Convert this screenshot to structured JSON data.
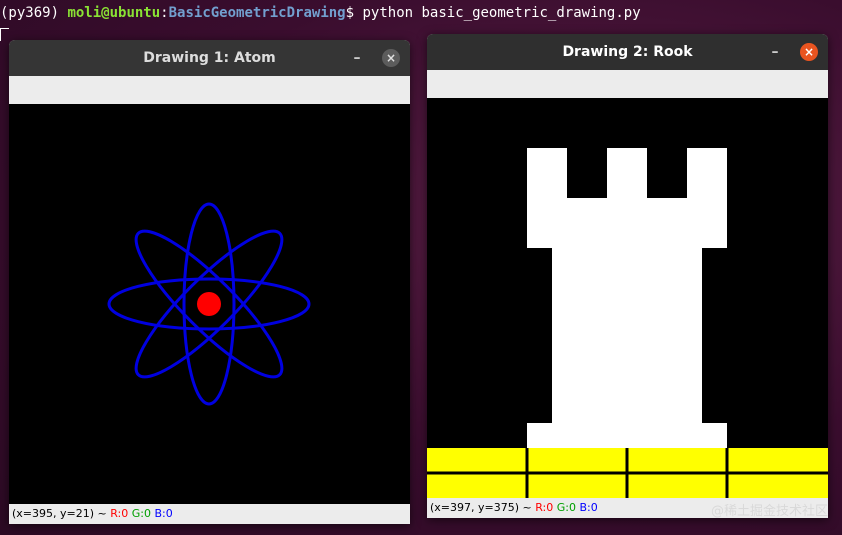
{
  "terminal": {
    "venv": "(py369)",
    "user_host": "moli@ubuntu",
    "path": "BasicGeometricDrawing",
    "prompt_symbol": "$",
    "command": "python basic_geometric_drawing.py"
  },
  "windows": [
    {
      "title": "Drawing 1: Atom",
      "status": {
        "coords": "(x=395, y=21) ~",
        "r": "R:0",
        "g": "G:0",
        "b": "B:0"
      },
      "drawing": {
        "ellipse_color": "#0000e0",
        "nucleus_color": "#ff0000",
        "background": "#000000"
      }
    },
    {
      "title": "Drawing 2: Rook",
      "status": {
        "coords": "(x=397, y=375) ~",
        "r": "R:0",
        "g": "G:0",
        "b": "B:0"
      },
      "drawing": {
        "rook_color": "#ffffff",
        "floor_color": "#ffff00",
        "line_color": "#000000",
        "background": "#000000"
      }
    }
  ],
  "controls": {
    "minimize": "–",
    "close": "×"
  },
  "watermark": "@稀土掘金技术社区"
}
